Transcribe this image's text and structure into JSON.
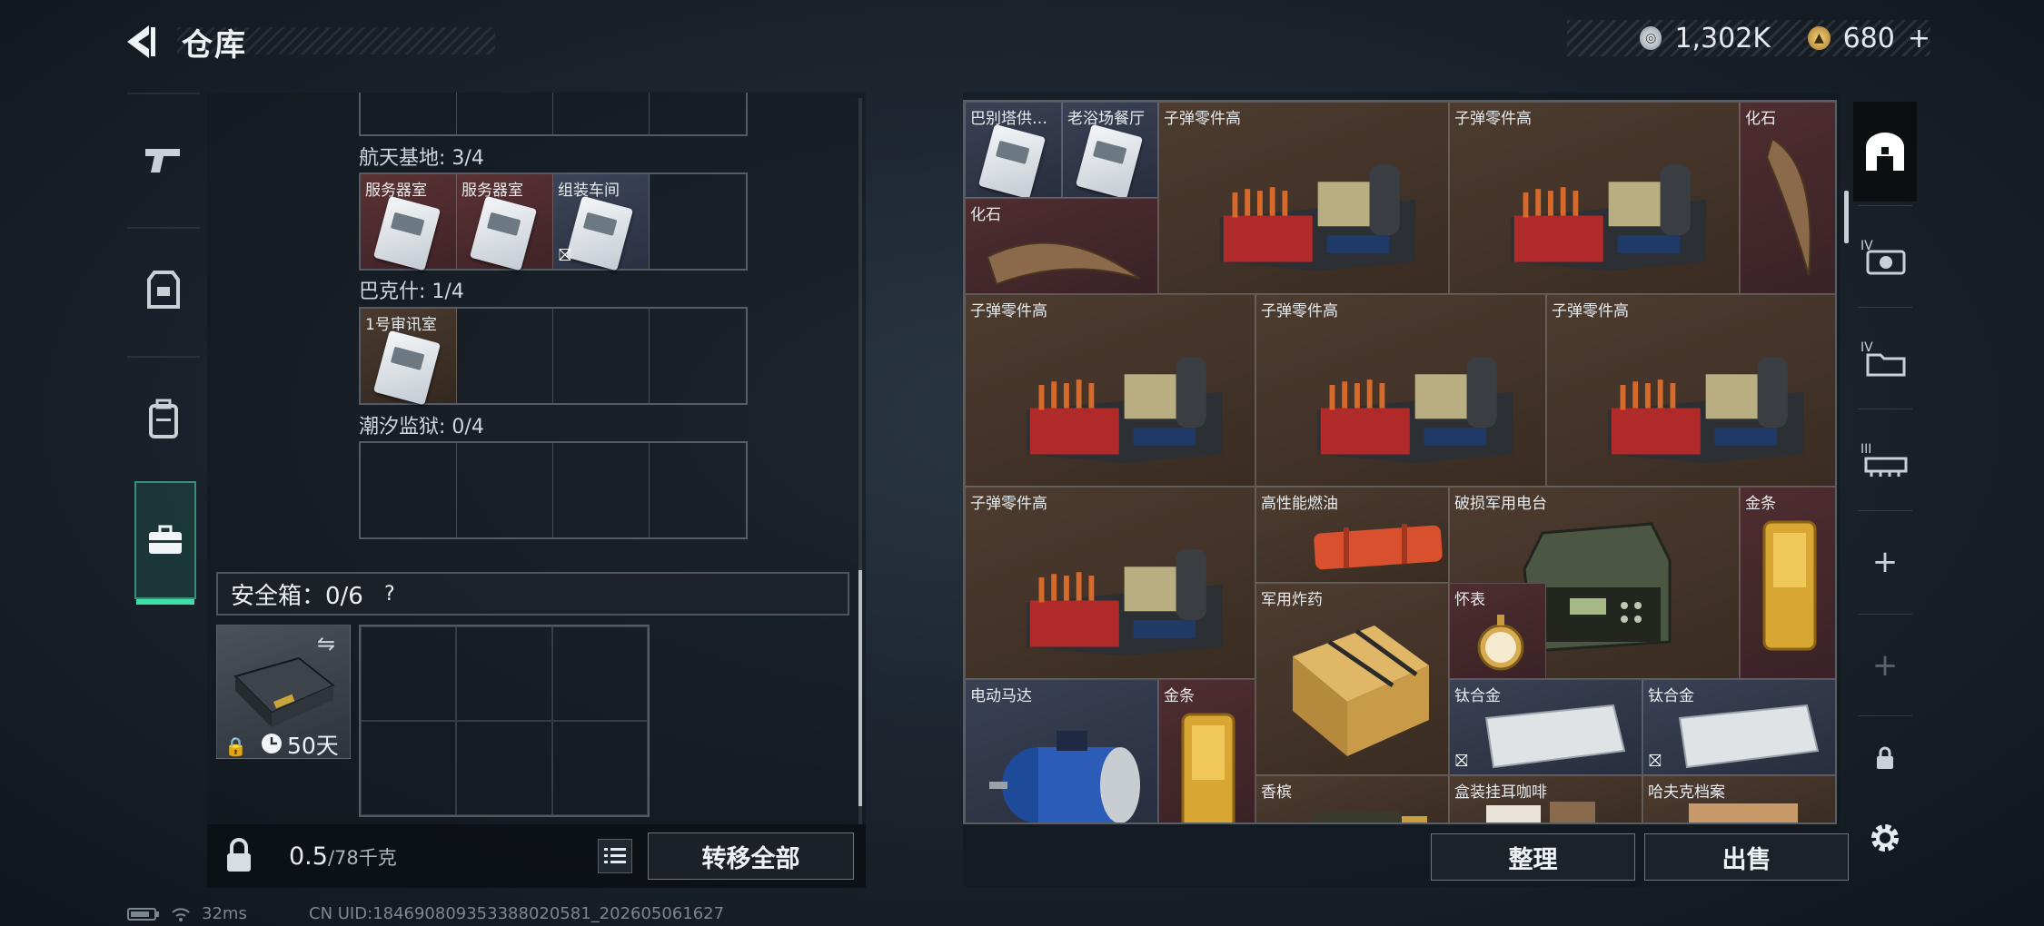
{
  "header": {
    "title": "仓库",
    "currency": [
      {
        "icon": "silver-coin-icon",
        "value": "1,302K"
      },
      {
        "icon": "gold-coin-icon",
        "value": "680"
      }
    ],
    "add_label": "+"
  },
  "left_tabs": [
    {
      "icon": "pistol-icon"
    },
    {
      "icon": "armor-icon"
    },
    {
      "icon": "backpack-icon"
    },
    {
      "icon": "briefcase-icon",
      "active": true
    }
  ],
  "keycards": {
    "sections": [
      {
        "label": "航天基地: 3/4",
        "items": [
          {
            "label": "服务器室",
            "bg": "red"
          },
          {
            "label": "服务器室",
            "bg": "red"
          },
          {
            "label": "组装车间",
            "bg": "blue",
            "no_drop": true
          }
        ]
      },
      {
        "label": "巴克什: 1/4",
        "items": [
          {
            "label": "1号审讯室",
            "bg": "brown"
          }
        ]
      },
      {
        "label": "潮汐监狱: 0/4",
        "items": []
      }
    ]
  },
  "safe_box": {
    "label": "安全箱：0/6",
    "help": "?",
    "duration": "50天"
  },
  "weight": {
    "current": "0.5",
    "unit": "/78千克"
  },
  "buttons": {
    "transfer_all": "转移全部",
    "sort": "整理",
    "sell": "出售"
  },
  "stash_items": [
    {
      "label": "巴别塔供…",
      "icon": "keycard-icon",
      "bg": "b"
    },
    {
      "label": "老浴场餐厅",
      "icon": "keycard-icon",
      "bg": "b"
    },
    {
      "label": "子弹零件高",
      "icon": "ammo-parts-icon",
      "bg": "br"
    },
    {
      "label": "子弹零件高",
      "icon": "ammo-parts-icon",
      "bg": "br"
    },
    {
      "label": "化石",
      "icon": "fossil-claw-icon",
      "bg": "r"
    },
    {
      "label": "化石",
      "icon": "fossil-claw-icon",
      "bg": "r"
    },
    {
      "label": "子弹零件高",
      "icon": "ammo-parts-icon",
      "bg": "br"
    },
    {
      "label": "子弹零件高",
      "icon": "ammo-parts-icon",
      "bg": "br"
    },
    {
      "label": "子弹零件高",
      "icon": "ammo-parts-icon",
      "bg": "br"
    },
    {
      "label": "子弹零件高",
      "icon": "ammo-parts-icon",
      "bg": "br"
    },
    {
      "label": "高性能燃油",
      "icon": "fuel-canister-icon",
      "bg": "br"
    },
    {
      "label": "破损军用电台",
      "icon": "radio-icon",
      "bg": "br"
    },
    {
      "label": "金条",
      "icon": "gold-bar-icon",
      "bg": "r"
    },
    {
      "label": "军用炸药",
      "icon": "explosive-crate-icon",
      "bg": "br"
    },
    {
      "label": "怀表",
      "icon": "pocket-watch-icon",
      "bg": "r"
    },
    {
      "label": "电动马达",
      "icon": "electric-motor-icon",
      "bg": "b"
    },
    {
      "label": "金条",
      "icon": "gold-bar-icon",
      "bg": "r"
    },
    {
      "label": "钛合金",
      "icon": "titanium-plate-icon",
      "bg": "b"
    },
    {
      "label": "钛合金",
      "icon": "titanium-plate-icon",
      "bg": "b"
    },
    {
      "label": "香槟",
      "icon": "champagne-icon",
      "bg": "br"
    },
    {
      "label": "盒装挂耳咖啡",
      "icon": "coffee-box-icon",
      "bg": "br"
    },
    {
      "label": "哈夫克档案",
      "icon": "document-icon",
      "bg": "br"
    }
  ],
  "right_tabs": [
    {
      "icon": "stash-icon",
      "active": true
    },
    {
      "icon": "tier4-camera-icon"
    },
    {
      "icon": "tier4-folder-icon"
    },
    {
      "icon": "tier3-rail-icon"
    },
    {
      "icon": "add-icon",
      "label": "+"
    },
    {
      "icon": "add-icon",
      "label": "+"
    },
    {
      "icon": "lock-icon"
    }
  ],
  "status": {
    "ping": "32ms",
    "uid": "CN UID:18469080935338802058​1_202605061627"
  }
}
